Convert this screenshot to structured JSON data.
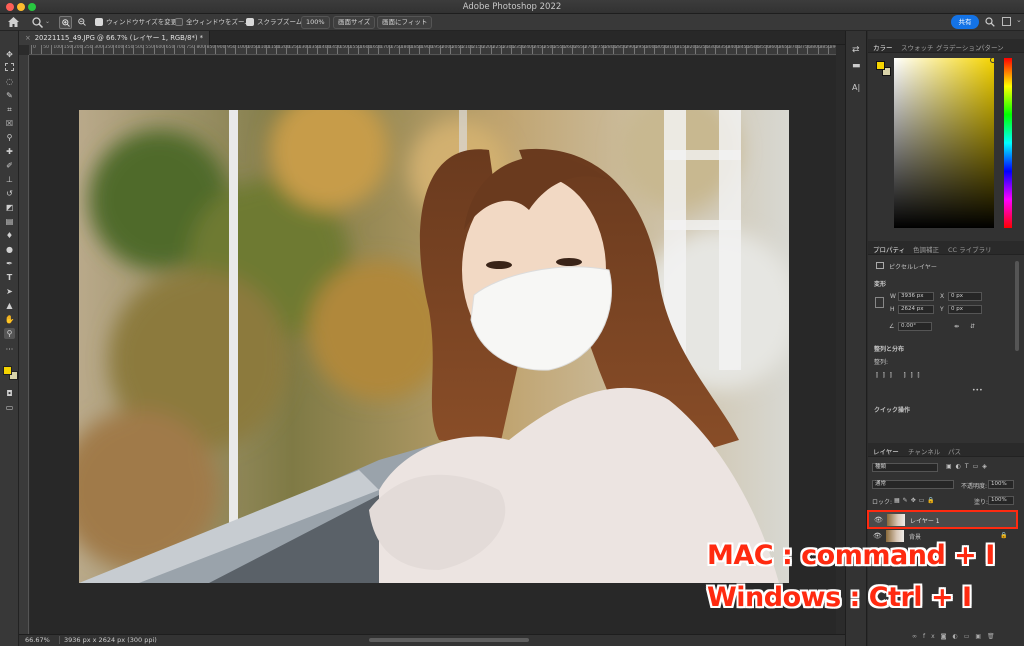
{
  "window": {
    "title": "Adobe Photoshop 2022",
    "colors": {
      "close": "#fe5f57",
      "minimize": "#febc2e",
      "zoom": "#28c840"
    }
  },
  "options_bar": {
    "home_icon": "home-icon",
    "zoom_icon": "magnifier-icon",
    "resize_windows_label": "ウィンドウサイズを変更",
    "zoom_all_label": "全ウィンドウをズーム",
    "scrubby_zoom_label": "スクラブズーム",
    "zoom_value": "100%",
    "fill_screen_label": "画面サイズ",
    "fit_screen_label": "画面にフィット",
    "share_label": "共有"
  },
  "document": {
    "tab_title": "20221115_49.JPG @ 66.7% (レイヤー 1, RGB/8*) *",
    "tab_close": "×",
    "ruler_ticks": [
      "0",
      "50",
      "100",
      "150",
      "200",
      "250",
      "300",
      "350",
      "400",
      "450",
      "500",
      "550",
      "600",
      "650",
      "700",
      "750",
      "800",
      "850",
      "900",
      "950",
      "1000",
      "1050",
      "1100",
      "1150",
      "1200",
      "1250",
      "1300",
      "1350",
      "1400",
      "1450",
      "1500",
      "1550",
      "1600",
      "1650",
      "1700",
      "1750",
      "1800",
      "1850",
      "1900",
      "1950",
      "2000",
      "2050",
      "2100",
      "2150",
      "2200",
      "2250",
      "2300",
      "2350",
      "2400",
      "2450",
      "2500",
      "2550",
      "2600",
      "2650",
      "2700",
      "2750",
      "2800",
      "2850",
      "2900",
      "2950",
      "3000",
      "3050",
      "3100",
      "3150",
      "3200",
      "3250",
      "3300",
      "3350",
      "3400",
      "3450",
      "3500",
      "3550",
      "3600",
      "3650",
      "3700",
      "3750",
      "3800",
      "3850",
      "3900"
    ]
  },
  "status": {
    "zoom": "66.67%",
    "doc_info": "3936 px x 2624 px (300 ppi)"
  },
  "color_panel": {
    "tabs": [
      "カラー",
      "スウォッチ",
      "グラデーション",
      "パターン"
    ],
    "foreground": "#f5d400",
    "background": "#d8d2a8"
  },
  "properties_panel": {
    "tabs": [
      "プロパティ",
      "色調補正",
      "CC ライブラリ"
    ],
    "layer_type": "ピクセルレイヤー",
    "transform_section": "変形",
    "w_label": "W",
    "w_value": "3936 px",
    "h_label": "H",
    "h_value": "2624 px",
    "x_label": "X",
    "x_value": "0 px",
    "y_label": "Y",
    "y_value": "0 px",
    "angle_value": "0.00°",
    "align_section": "整列と分布",
    "align_label": "整列:",
    "more": "•••",
    "quick_actions": "クイック操作"
  },
  "layers_panel": {
    "tabs": [
      "レイヤー",
      "チャンネル",
      "パス"
    ],
    "filter_label": "種類",
    "blend_mode": "通常",
    "opacity_label": "不透明度:",
    "opacity_value": "100%",
    "lock_label": "ロック:",
    "fill_label": "塗り:",
    "fill_value": "100%",
    "layers": [
      {
        "name": "レイヤー 1",
        "selected": true
      },
      {
        "name": "背景",
        "selected": false
      }
    ]
  },
  "annotation": {
    "mac_shortcut": "MAC : command + I",
    "windows_shortcut": "Windows : Ctrl + I",
    "highlight_color": "#ff2a10"
  }
}
